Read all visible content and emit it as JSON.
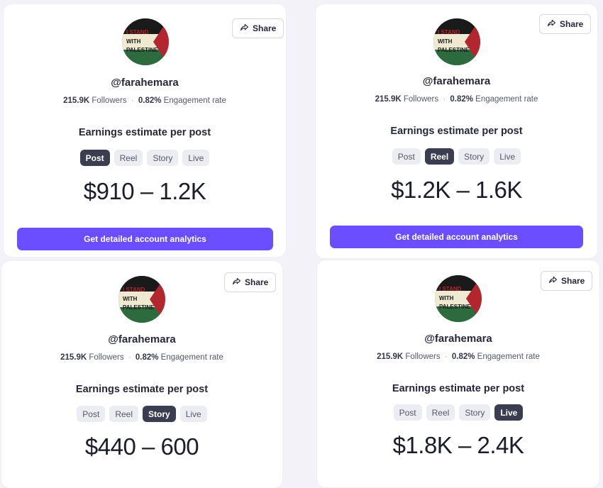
{
  "profile": {
    "handle": "@farahemara",
    "followers_value": "215.9K",
    "followers_label": "Followers",
    "separator": "·",
    "engagement_value": "0.82%",
    "engagement_label": "Engagement rate",
    "avatar_lines": [
      "I STAND",
      "WITH",
      "PALESTINE"
    ]
  },
  "share_label": "Share",
  "estimate_title": "Earnings estimate per post",
  "tabs": [
    "Post",
    "Reel",
    "Story",
    "Live"
  ],
  "cta_label": "Get detailed account analytics",
  "cards": [
    {
      "active_tab": "Post",
      "price": "$910 – 1.2K"
    },
    {
      "active_tab": "Reel",
      "price": "$1.2K – 1.6K"
    },
    {
      "active_tab": "Story",
      "price": "$440 – 600"
    },
    {
      "active_tab": "Live",
      "price": "$1.8K – 2.4K"
    }
  ],
  "colors": {
    "accent": "#6b4eff",
    "active_tab_bg": "#3a3e50",
    "flag_black": "#1a1a1a",
    "flag_white": "#efe9d2",
    "flag_green": "#2d6a3e",
    "flag_red": "#b3262d"
  }
}
